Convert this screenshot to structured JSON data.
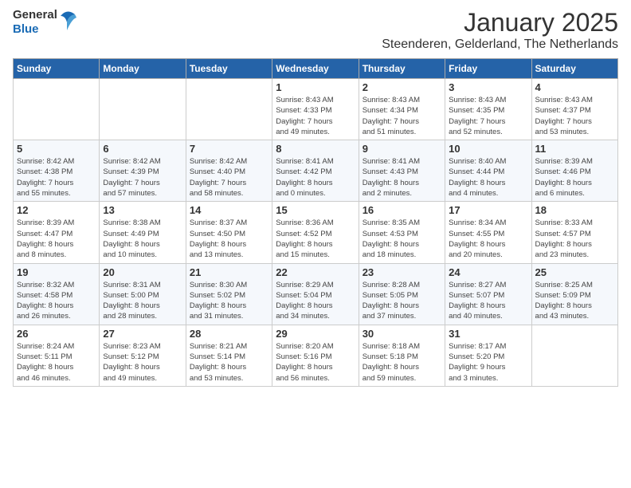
{
  "header": {
    "logo_general": "General",
    "logo_blue": "Blue",
    "main_title": "January 2025",
    "subtitle": "Steenderen, Gelderland, The Netherlands"
  },
  "weekdays": [
    "Sunday",
    "Monday",
    "Tuesday",
    "Wednesday",
    "Thursday",
    "Friday",
    "Saturday"
  ],
  "weeks": [
    [
      {
        "day": "",
        "info": ""
      },
      {
        "day": "",
        "info": ""
      },
      {
        "day": "",
        "info": ""
      },
      {
        "day": "1",
        "info": "Sunrise: 8:43 AM\nSunset: 4:33 PM\nDaylight: 7 hours\nand 49 minutes."
      },
      {
        "day": "2",
        "info": "Sunrise: 8:43 AM\nSunset: 4:34 PM\nDaylight: 7 hours\nand 51 minutes."
      },
      {
        "day": "3",
        "info": "Sunrise: 8:43 AM\nSunset: 4:35 PM\nDaylight: 7 hours\nand 52 minutes."
      },
      {
        "day": "4",
        "info": "Sunrise: 8:43 AM\nSunset: 4:37 PM\nDaylight: 7 hours\nand 53 minutes."
      }
    ],
    [
      {
        "day": "5",
        "info": "Sunrise: 8:42 AM\nSunset: 4:38 PM\nDaylight: 7 hours\nand 55 minutes."
      },
      {
        "day": "6",
        "info": "Sunrise: 8:42 AM\nSunset: 4:39 PM\nDaylight: 7 hours\nand 57 minutes."
      },
      {
        "day": "7",
        "info": "Sunrise: 8:42 AM\nSunset: 4:40 PM\nDaylight: 7 hours\nand 58 minutes."
      },
      {
        "day": "8",
        "info": "Sunrise: 8:41 AM\nSunset: 4:42 PM\nDaylight: 8 hours\nand 0 minutes."
      },
      {
        "day": "9",
        "info": "Sunrise: 8:41 AM\nSunset: 4:43 PM\nDaylight: 8 hours\nand 2 minutes."
      },
      {
        "day": "10",
        "info": "Sunrise: 8:40 AM\nSunset: 4:44 PM\nDaylight: 8 hours\nand 4 minutes."
      },
      {
        "day": "11",
        "info": "Sunrise: 8:39 AM\nSunset: 4:46 PM\nDaylight: 8 hours\nand 6 minutes."
      }
    ],
    [
      {
        "day": "12",
        "info": "Sunrise: 8:39 AM\nSunset: 4:47 PM\nDaylight: 8 hours\nand 8 minutes."
      },
      {
        "day": "13",
        "info": "Sunrise: 8:38 AM\nSunset: 4:49 PM\nDaylight: 8 hours\nand 10 minutes."
      },
      {
        "day": "14",
        "info": "Sunrise: 8:37 AM\nSunset: 4:50 PM\nDaylight: 8 hours\nand 13 minutes."
      },
      {
        "day": "15",
        "info": "Sunrise: 8:36 AM\nSunset: 4:52 PM\nDaylight: 8 hours\nand 15 minutes."
      },
      {
        "day": "16",
        "info": "Sunrise: 8:35 AM\nSunset: 4:53 PM\nDaylight: 8 hours\nand 18 minutes."
      },
      {
        "day": "17",
        "info": "Sunrise: 8:34 AM\nSunset: 4:55 PM\nDaylight: 8 hours\nand 20 minutes."
      },
      {
        "day": "18",
        "info": "Sunrise: 8:33 AM\nSunset: 4:57 PM\nDaylight: 8 hours\nand 23 minutes."
      }
    ],
    [
      {
        "day": "19",
        "info": "Sunrise: 8:32 AM\nSunset: 4:58 PM\nDaylight: 8 hours\nand 26 minutes."
      },
      {
        "day": "20",
        "info": "Sunrise: 8:31 AM\nSunset: 5:00 PM\nDaylight: 8 hours\nand 28 minutes."
      },
      {
        "day": "21",
        "info": "Sunrise: 8:30 AM\nSunset: 5:02 PM\nDaylight: 8 hours\nand 31 minutes."
      },
      {
        "day": "22",
        "info": "Sunrise: 8:29 AM\nSunset: 5:04 PM\nDaylight: 8 hours\nand 34 minutes."
      },
      {
        "day": "23",
        "info": "Sunrise: 8:28 AM\nSunset: 5:05 PM\nDaylight: 8 hours\nand 37 minutes."
      },
      {
        "day": "24",
        "info": "Sunrise: 8:27 AM\nSunset: 5:07 PM\nDaylight: 8 hours\nand 40 minutes."
      },
      {
        "day": "25",
        "info": "Sunrise: 8:25 AM\nSunset: 5:09 PM\nDaylight: 8 hours\nand 43 minutes."
      }
    ],
    [
      {
        "day": "26",
        "info": "Sunrise: 8:24 AM\nSunset: 5:11 PM\nDaylight: 8 hours\nand 46 minutes."
      },
      {
        "day": "27",
        "info": "Sunrise: 8:23 AM\nSunset: 5:12 PM\nDaylight: 8 hours\nand 49 minutes."
      },
      {
        "day": "28",
        "info": "Sunrise: 8:21 AM\nSunset: 5:14 PM\nDaylight: 8 hours\nand 53 minutes."
      },
      {
        "day": "29",
        "info": "Sunrise: 8:20 AM\nSunset: 5:16 PM\nDaylight: 8 hours\nand 56 minutes."
      },
      {
        "day": "30",
        "info": "Sunrise: 8:18 AM\nSunset: 5:18 PM\nDaylight: 8 hours\nand 59 minutes."
      },
      {
        "day": "31",
        "info": "Sunrise: 8:17 AM\nSunset: 5:20 PM\nDaylight: 9 hours\nand 3 minutes."
      },
      {
        "day": "",
        "info": ""
      }
    ]
  ]
}
